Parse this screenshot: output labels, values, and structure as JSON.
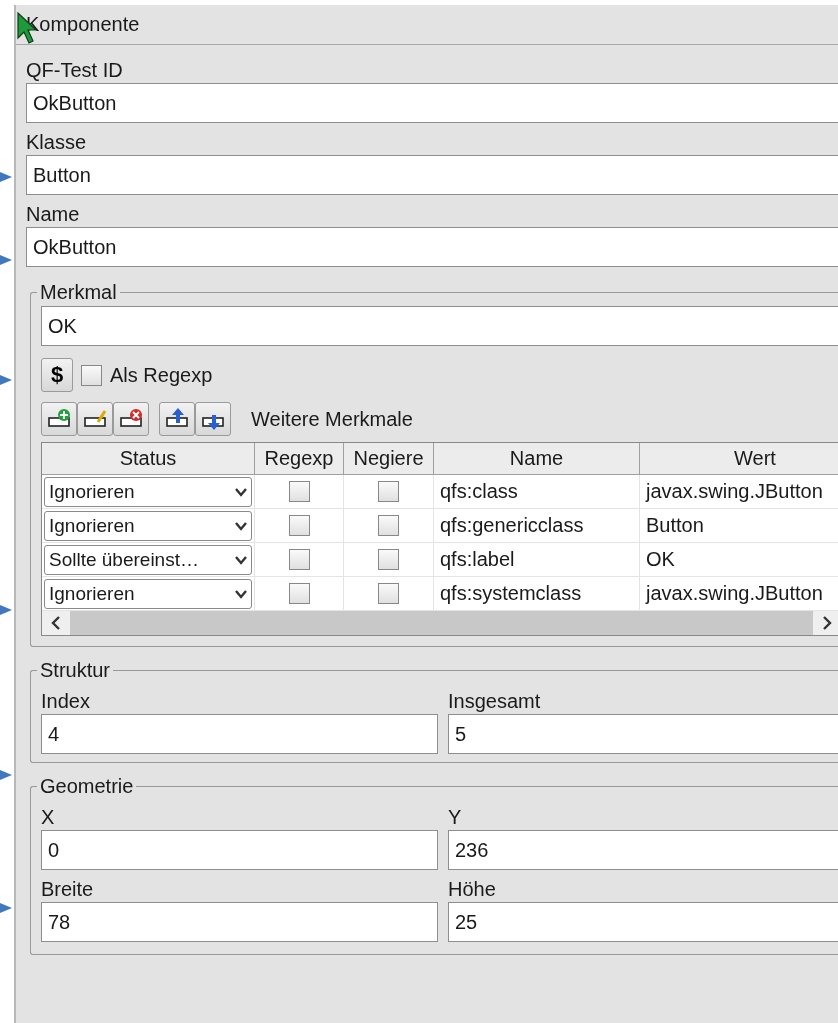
{
  "header": {
    "title": "Komponente"
  },
  "fields": [
    {
      "label": "QF-Test ID",
      "value": "OkButton"
    },
    {
      "label": "Klasse",
      "value": "Button"
    },
    {
      "label": "Name",
      "value": "OkButton"
    }
  ],
  "merkmal": {
    "legend": "Merkmal",
    "value": "OK",
    "dollar_button": "$",
    "regexp_checkbox": {
      "label": "Als Regexp",
      "checked": false
    },
    "table_label": "Weitere Merkmale",
    "columns": [
      "Status",
      "Regexp",
      "Negiere",
      "Name",
      "Wert"
    ],
    "rows": [
      {
        "status": "Ignorieren",
        "regexp": false,
        "negate": false,
        "name": "qfs:class",
        "value": "javax.swing.JButton"
      },
      {
        "status": "Ignorieren",
        "regexp": false,
        "negate": false,
        "name": "qfs:genericclass",
        "value": "Button"
      },
      {
        "status": "Sollte übereinst…",
        "regexp": false,
        "negate": false,
        "name": "qfs:label",
        "value": "OK"
      },
      {
        "status": "Ignorieren",
        "regexp": false,
        "negate": false,
        "name": "qfs:systemclass",
        "value": "javax.swing.JButton"
      }
    ]
  },
  "struktur": {
    "legend": "Struktur",
    "fields": [
      {
        "label": "Index",
        "value": "4"
      },
      {
        "label": "Insgesamt",
        "value": "5"
      }
    ]
  },
  "geometrie": {
    "legend": "Geometrie",
    "fields": [
      {
        "label": "X",
        "value": "0"
      },
      {
        "label": "Y",
        "value": "236"
      },
      {
        "label": "Breite",
        "value": "78"
      },
      {
        "label": "Höhe",
        "value": "25"
      }
    ]
  }
}
